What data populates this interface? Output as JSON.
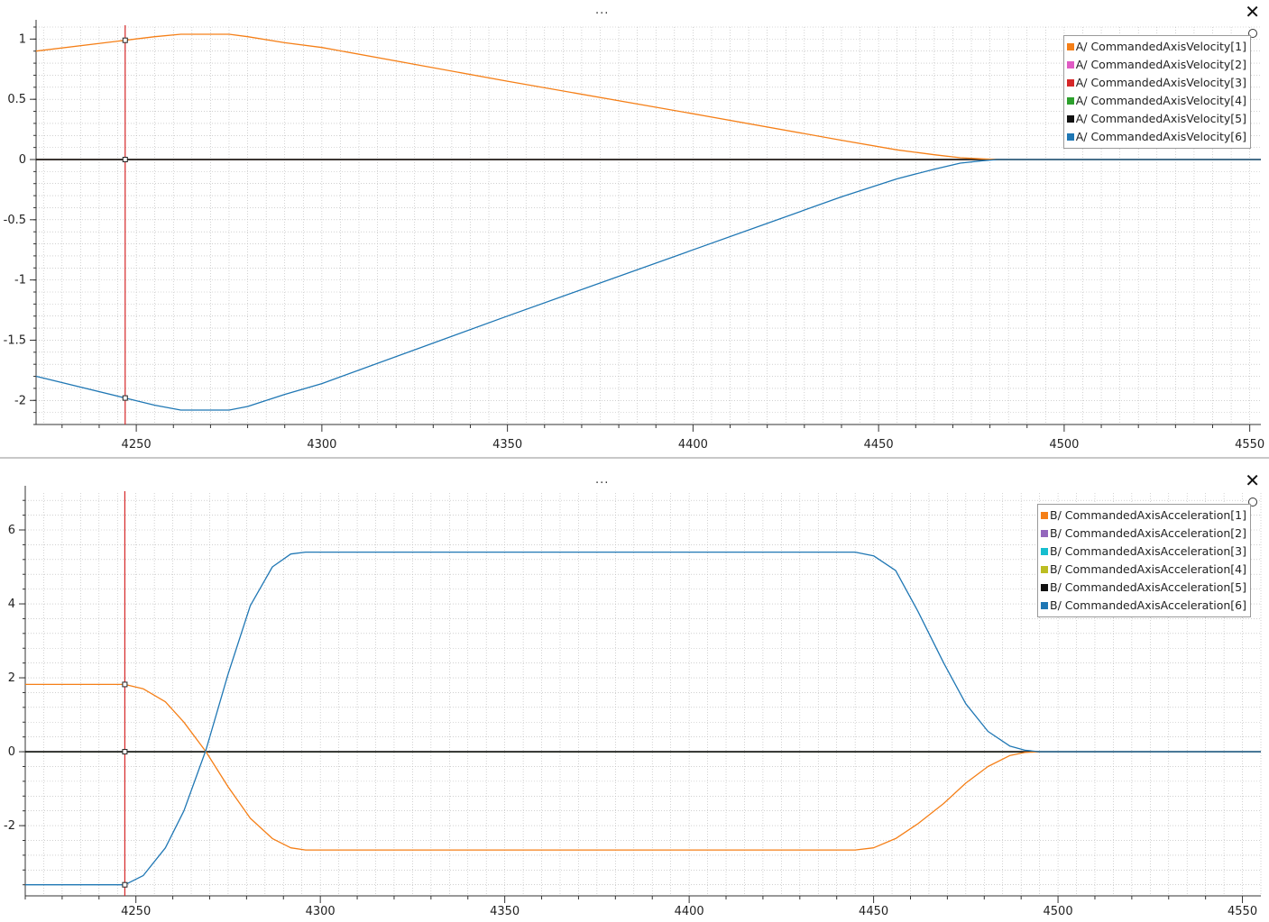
{
  "panels": [
    {
      "menu_label": "...",
      "close_label": "✕",
      "legend": [
        {
          "label": "A/ CommandedAxisVelocity[1]",
          "color": "#f57f17"
        },
        {
          "label": "A/ CommandedAxisVelocity[2]",
          "color": "#e05bc4"
        },
        {
          "label": "A/ CommandedAxisVelocity[3]",
          "color": "#d62728"
        },
        {
          "label": "A/ CommandedAxisVelocity[4]",
          "color": "#2ca02c"
        },
        {
          "label": "A/ CommandedAxisVelocity[5]",
          "color": "#111111"
        },
        {
          "label": "A/ CommandedAxisVelocity[6]",
          "color": "#1f77b4"
        }
      ]
    },
    {
      "menu_label": "...",
      "close_label": "✕",
      "legend": [
        {
          "label": "B/ CommandedAxisAcceleration[1]",
          "color": "#f57f17"
        },
        {
          "label": "B/ CommandedAxisAcceleration[2]",
          "color": "#9467bd"
        },
        {
          "label": "B/ CommandedAxisAcceleration[3]",
          "color": "#17becf"
        },
        {
          "label": "B/ CommandedAxisAcceleration[4]",
          "color": "#bcbd22"
        },
        {
          "label": "B/ CommandedAxisAcceleration[5]",
          "color": "#111111"
        },
        {
          "label": "B/ CommandedAxisAcceleration[6]",
          "color": "#1f77b4"
        }
      ]
    }
  ],
  "chart_data": [
    {
      "type": "line",
      "xlim": [
        4223,
        4553
      ],
      "ylim": [
        -2.2,
        1.1
      ],
      "x_ticks": [
        4250,
        4300,
        4350,
        4400,
        4450,
        4500,
        4550
      ],
      "y_ticks": [
        1,
        0.5,
        0,
        -0.5,
        -1,
        -1.5,
        -2
      ],
      "y_tick_labels": [
        "1",
        "0.5",
        "0",
        "-0.5",
        "-1",
        "-1.5",
        "-2"
      ],
      "grid": true,
      "legend_position": "top-right",
      "cursor_x": 4247,
      "series": [
        {
          "name": "A/ CommandedAxisVelocity[1]",
          "color": "#f57f17",
          "x": [
            4223,
            4247,
            4255,
            4262,
            4270,
            4275,
            4280,
            4290,
            4300,
            4350,
            4400,
            4440,
            4455,
            4465,
            4472,
            4478,
            4482,
            4488,
            4553
          ],
          "y": [
            0.9,
            0.99,
            1.02,
            1.04,
            1.04,
            1.04,
            1.02,
            0.97,
            0.93,
            0.65,
            0.38,
            0.16,
            0.08,
            0.04,
            0.015,
            0.005,
            0,
            0,
            0
          ]
        },
        {
          "name": "A/ CommandedAxisVelocity[2]",
          "color": "#e05bc4",
          "x": [
            4223,
            4553
          ],
          "y": [
            0,
            0
          ]
        },
        {
          "name": "A/ CommandedAxisVelocity[3]",
          "color": "#d62728",
          "x": [
            4223,
            4553
          ],
          "y": [
            0,
            0
          ]
        },
        {
          "name": "A/ CommandedAxisVelocity[4]",
          "color": "#2ca02c",
          "x": [
            4223,
            4553
          ],
          "y": [
            0,
            0
          ]
        },
        {
          "name": "A/ CommandedAxisVelocity[5]",
          "color": "#111111",
          "x": [
            4223,
            4553
          ],
          "y": [
            0,
            0
          ]
        },
        {
          "name": "A/ CommandedAxisVelocity[6]",
          "color": "#1f77b4",
          "x": [
            4223,
            4247,
            4255,
            4262,
            4270,
            4275,
            4280,
            4290,
            4300,
            4350,
            4400,
            4440,
            4455,
            4465,
            4472,
            4478,
            4482,
            4488,
            4553
          ],
          "y": [
            -1.8,
            -1.98,
            -2.04,
            -2.08,
            -2.08,
            -2.08,
            -2.05,
            -1.95,
            -1.86,
            -1.3,
            -0.75,
            -0.31,
            -0.16,
            -0.08,
            -0.03,
            -0.01,
            0,
            0,
            0
          ]
        }
      ]
    },
    {
      "type": "line",
      "xlim": [
        4220,
        4555
      ],
      "ylim": [
        -3.9,
        7.0
      ],
      "x_ticks": [
        4250,
        4300,
        4350,
        4400,
        4450,
        4500,
        4550
      ],
      "y_ticks": [
        6,
        4,
        2,
        0,
        -2
      ],
      "y_tick_labels": [
        "6",
        "4",
        "2",
        "0",
        "-2"
      ],
      "grid": true,
      "legend_position": "top-right",
      "cursor_x": 4247,
      "series": [
        {
          "name": "B/ CommandedAxisAcceleration[1]",
          "color": "#f57f17",
          "x": [
            4220,
            4247,
            4252,
            4258,
            4263,
            4269,
            4275,
            4281,
            4287,
            4292,
            4296,
            4300,
            4445,
            4450,
            4456,
            4462,
            4469,
            4475,
            4481,
            4487,
            4491,
            4495,
            4555
          ],
          "y": [
            1.82,
            1.82,
            1.7,
            1.35,
            0.8,
            0.0,
            -0.95,
            -1.8,
            -2.35,
            -2.6,
            -2.66,
            -2.66,
            -2.66,
            -2.6,
            -2.35,
            -1.95,
            -1.4,
            -0.85,
            -0.4,
            -0.1,
            -0.02,
            0,
            0
          ]
        },
        {
          "name": "B/ CommandedAxisAcceleration[2]",
          "color": "#9467bd",
          "x": [
            4220,
            4555
          ],
          "y": [
            0,
            0
          ]
        },
        {
          "name": "B/ CommandedAxisAcceleration[3]",
          "color": "#17becf",
          "x": [
            4220,
            4555
          ],
          "y": [
            0,
            0
          ]
        },
        {
          "name": "B/ CommandedAxisAcceleration[4]",
          "color": "#bcbd22",
          "x": [
            4220,
            4555
          ],
          "y": [
            0,
            0
          ]
        },
        {
          "name": "B/ CommandedAxisAcceleration[5]",
          "color": "#111111",
          "x": [
            4220,
            4555
          ],
          "y": [
            0,
            0
          ]
        },
        {
          "name": "B/ CommandedAxisAcceleration[6]",
          "color": "#1f77b4",
          "x": [
            4220,
            4247,
            4252,
            4258,
            4263,
            4269,
            4275,
            4281,
            4287,
            4292,
            4296,
            4300,
            4445,
            4450,
            4456,
            4462,
            4469,
            4475,
            4481,
            4487,
            4491,
            4495,
            4555
          ],
          "y": [
            -3.6,
            -3.6,
            -3.35,
            -2.6,
            -1.6,
            0.05,
            2.1,
            3.95,
            5.0,
            5.35,
            5.4,
            5.4,
            5.4,
            5.3,
            4.9,
            3.8,
            2.4,
            1.3,
            0.55,
            0.15,
            0.04,
            0,
            0
          ]
        }
      ]
    }
  ]
}
